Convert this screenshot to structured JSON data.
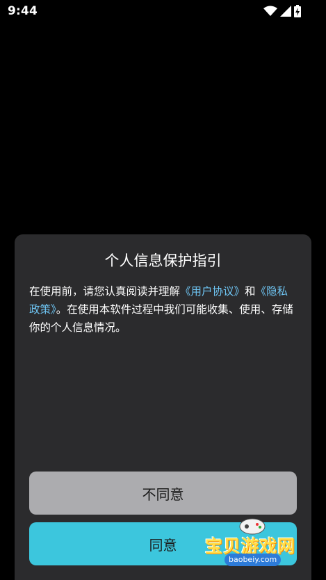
{
  "status_bar": {
    "time": "9:44",
    "icons": [
      "wifi-icon",
      "signal-icon",
      "battery-charging-icon"
    ]
  },
  "dialog": {
    "title": "个人信息保护指引",
    "body": {
      "line1_prefix": "在使用前，请您认真阅读并理解",
      "link_user_agreement": "《用户协议》",
      "connector": "和",
      "link_privacy_policy": "《隐私政策》",
      "suffix": "。在使用本软件过程中我们可能收集、使用、存储你的个人信息情况。"
    },
    "buttons": {
      "disagree": "不同意",
      "agree": "同意"
    }
  },
  "watermark": {
    "text": "宝贝游戏网",
    "url": "baobeiy.com"
  },
  "colors": {
    "background": "#000000",
    "dialog_bg": "#2b2b2d",
    "link": "#6ec4f2",
    "disagree_button": "#acacaf",
    "agree_button": "#3cc6dd"
  }
}
